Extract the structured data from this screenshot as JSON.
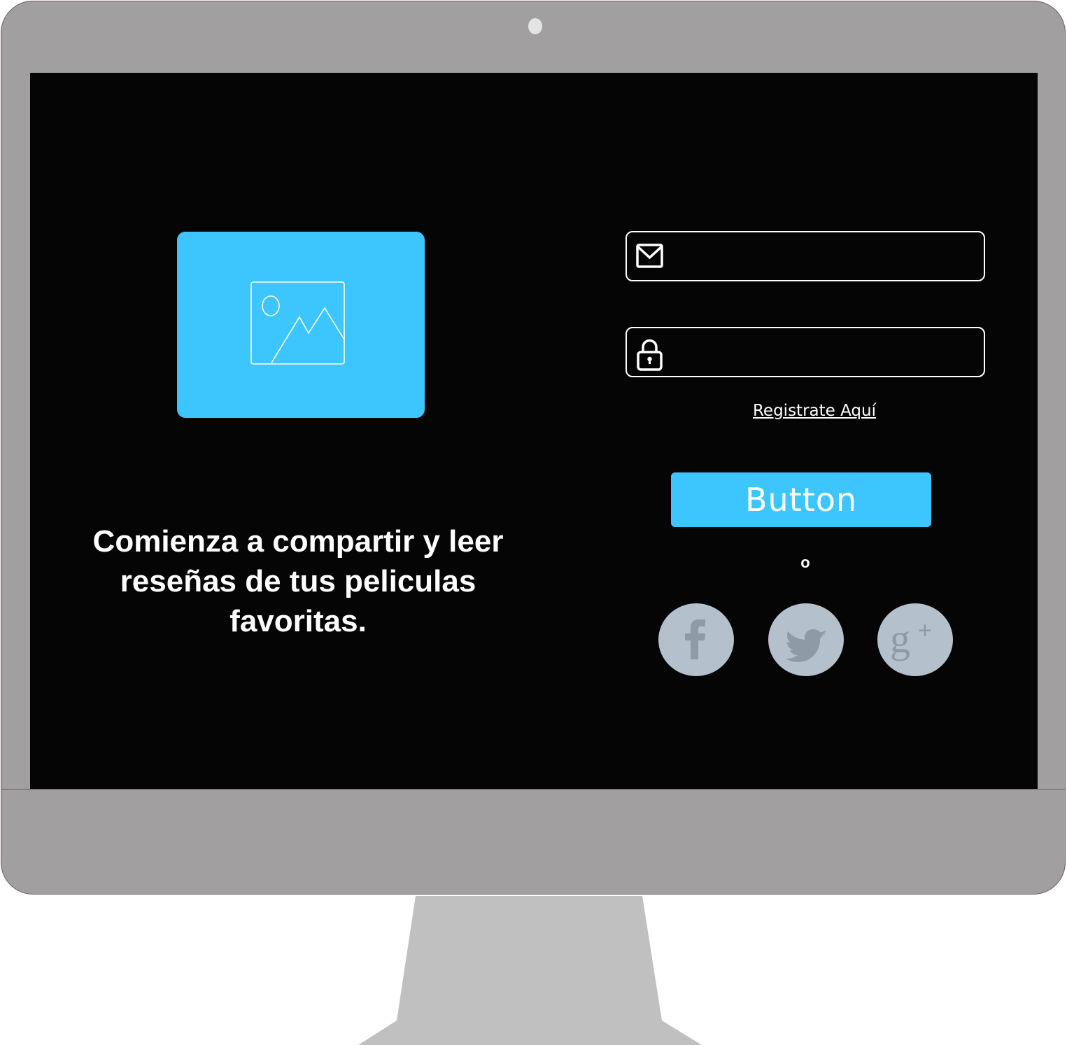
{
  "hero": {
    "tagline": "Comienza a compartir y leer reseñas de tus peliculas favoritas.",
    "image_icon": "image-placeholder-icon"
  },
  "login": {
    "email_icon": "mail-icon",
    "email_value": "",
    "password_icon": "lock-icon",
    "password_value": "",
    "register_link": "Registrate Aquí",
    "submit_label": "Button",
    "separator": "o"
  },
  "social": [
    {
      "name": "facebook",
      "icon": "facebook-icon"
    },
    {
      "name": "twitter",
      "icon": "twitter-icon"
    },
    {
      "name": "google-plus",
      "icon": "google-plus-icon"
    }
  ],
  "colors": {
    "accent": "#3dc6fe",
    "screen_bg": "#050505",
    "monitor_frame": "#a19fa0",
    "stand": "#c1c0c1",
    "social_bg": "#b4c0cb",
    "social_glyph": "#8e9aa5"
  }
}
